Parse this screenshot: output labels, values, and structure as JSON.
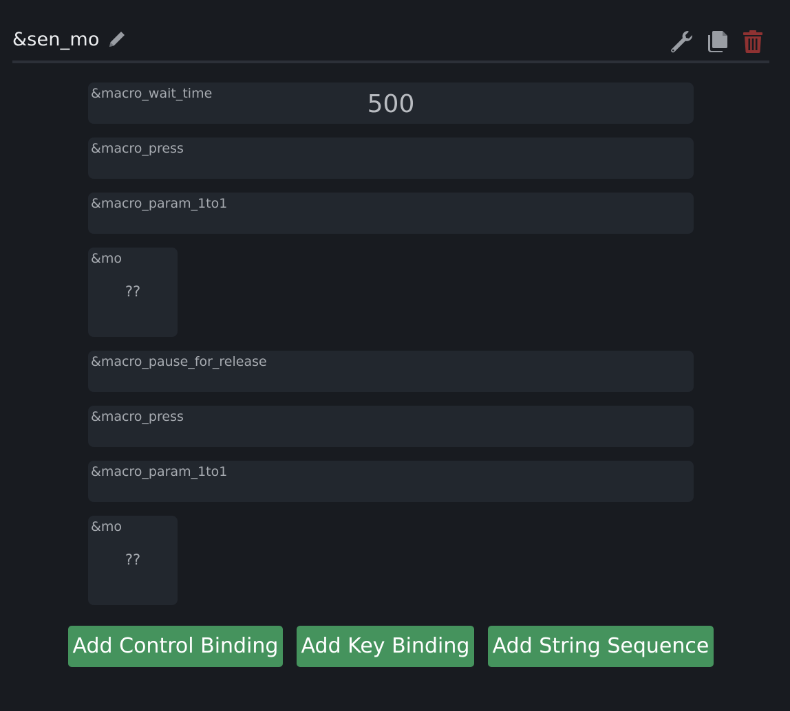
{
  "header": {
    "title": "&sen_mo"
  },
  "colors": {
    "background": "#181b20",
    "row_bg": "#22272e",
    "button_green": "#45935d",
    "delete_red": "#8f3232",
    "icon_gray": "#9a9ea4"
  },
  "icons": {
    "edit": "pencil-icon",
    "settings": "wrench-icon",
    "duplicate": "copy-icon",
    "delete": "trash-icon"
  },
  "bindings": [
    {
      "label": "&macro_wait_time",
      "value": "500"
    },
    {
      "label": "&macro_press",
      "value": ""
    },
    {
      "label": "&macro_param_1to1",
      "value": ""
    },
    {
      "label": "&mo",
      "param": "??"
    },
    {
      "label": "&macro_pause_for_release",
      "value": ""
    },
    {
      "label": "&macro_press",
      "value": ""
    },
    {
      "label": "&macro_param_1to1",
      "value": ""
    },
    {
      "label": "&mo",
      "param": "??"
    }
  ],
  "buttons": {
    "add_control": "Add Control Binding",
    "add_key": "Add Key Binding",
    "add_string": "Add String Sequence"
  }
}
